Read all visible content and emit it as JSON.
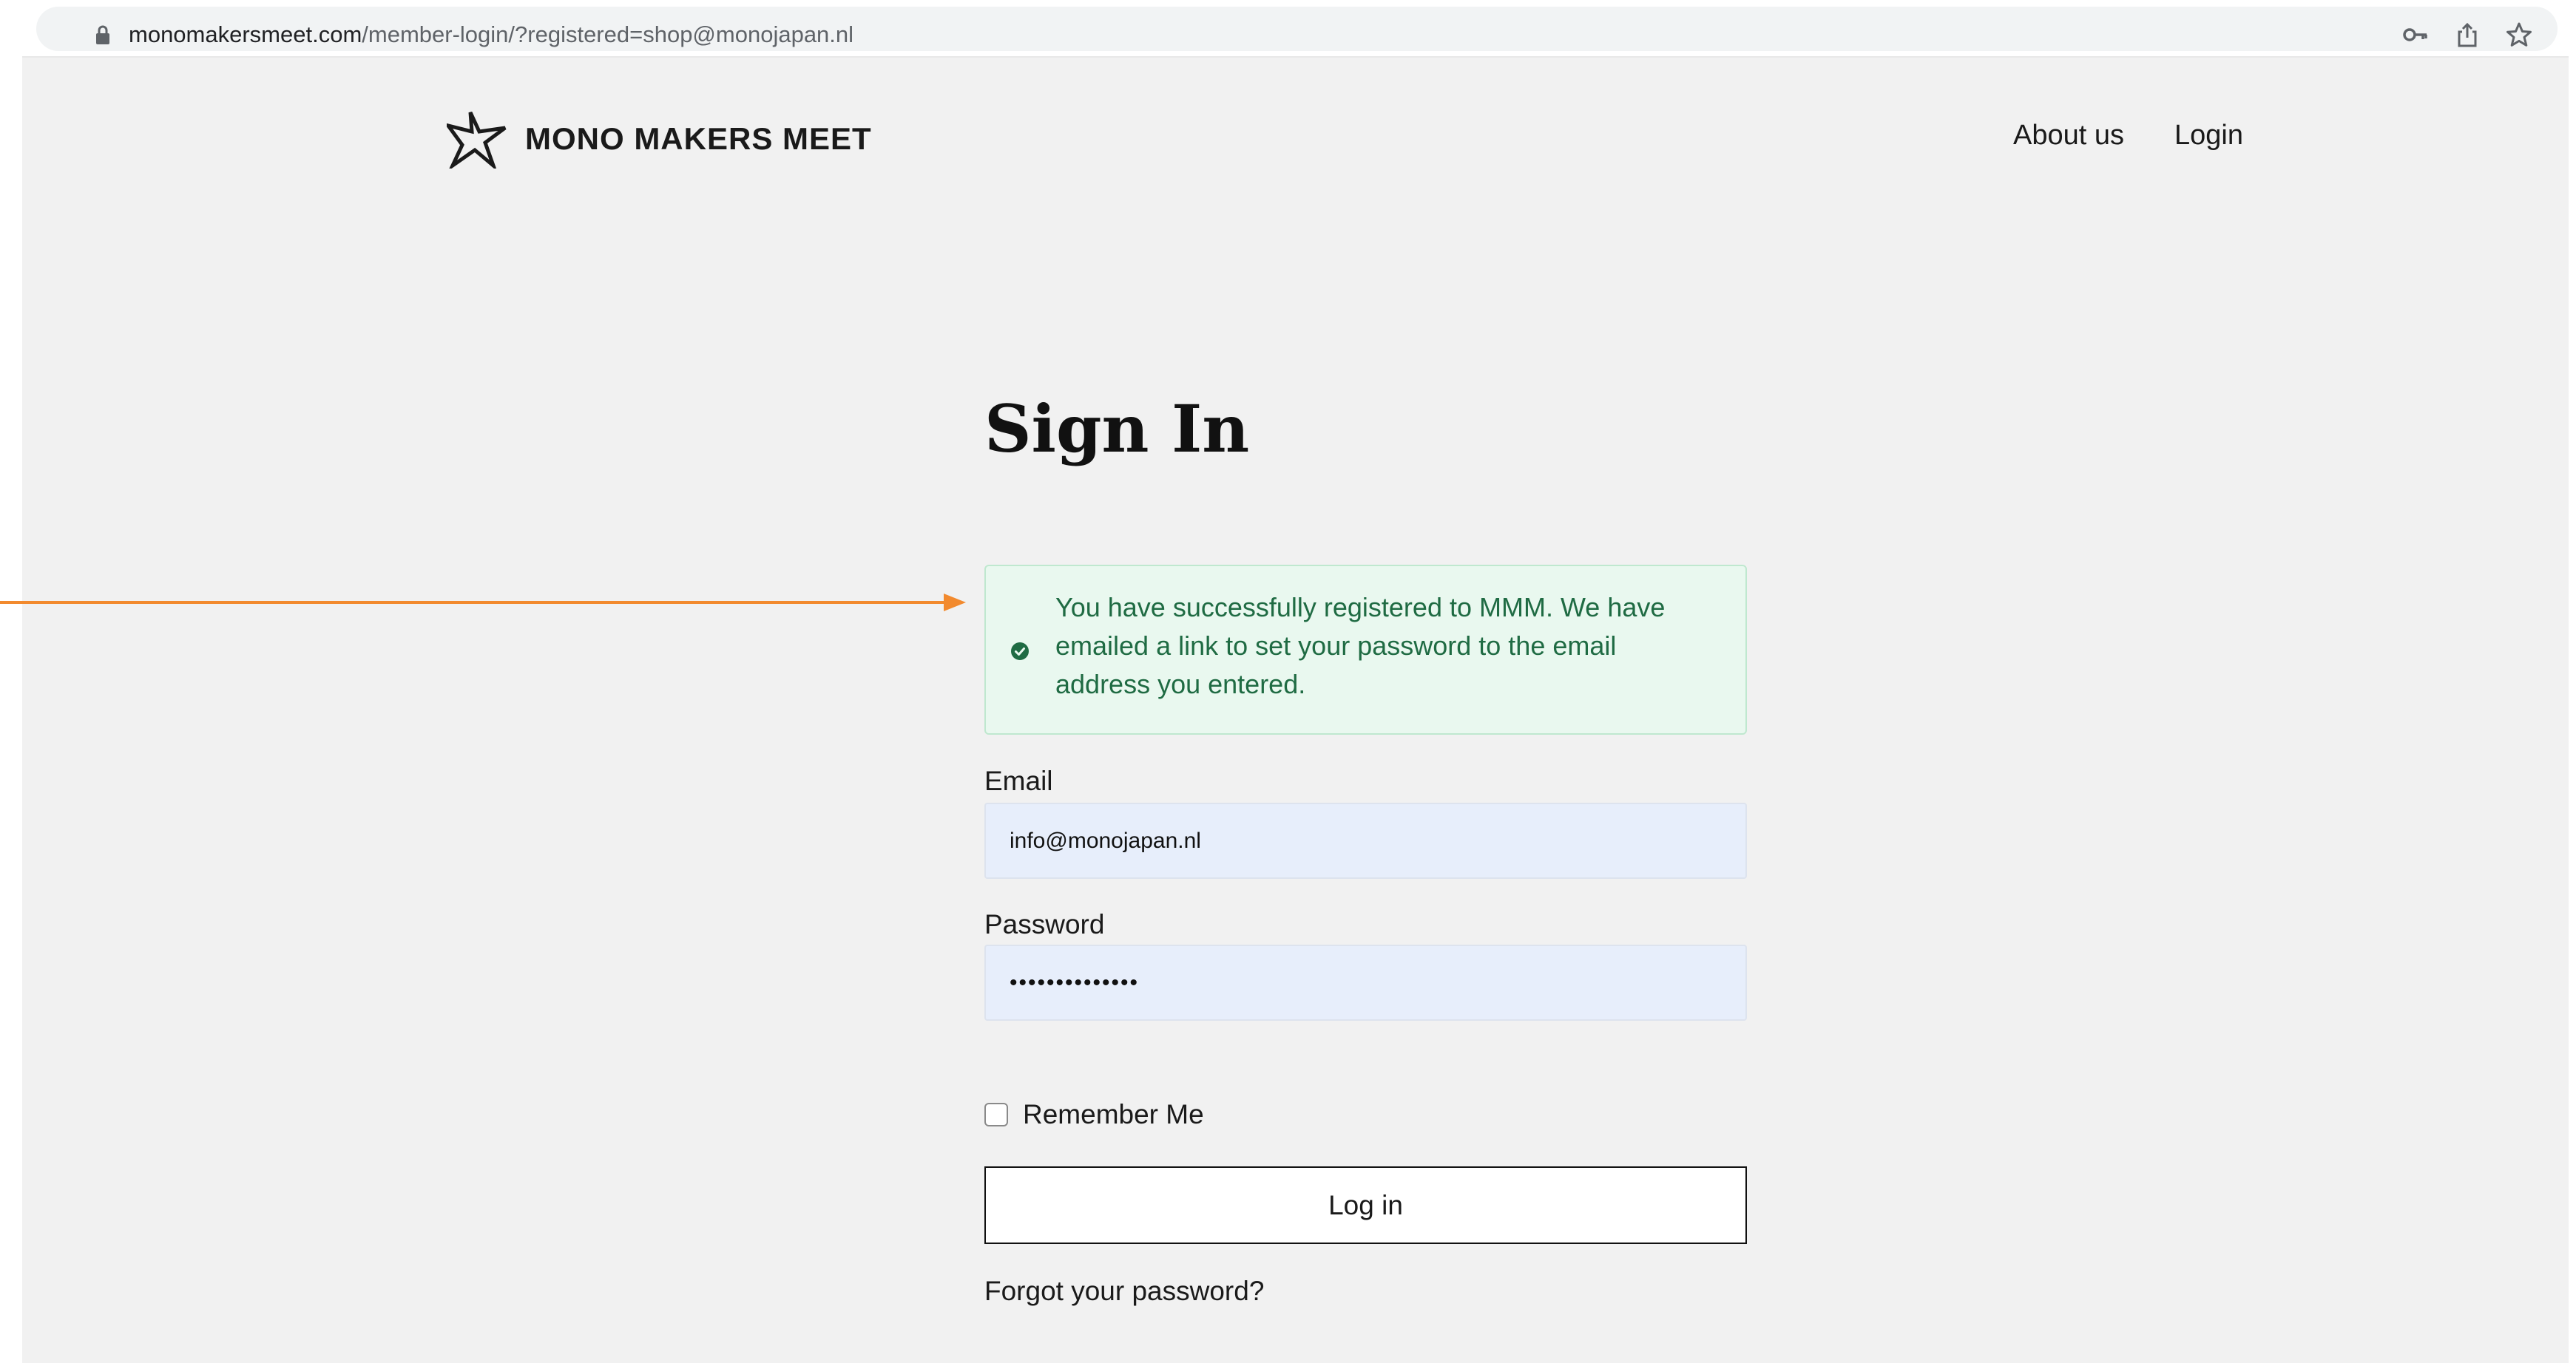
{
  "browser": {
    "url_domain": "monomakersmeet.com",
    "url_path": "/member-login/?registered=shop@monojapan.nl",
    "icons": [
      "lock-icon",
      "key-icon",
      "share-icon",
      "star-icon"
    ]
  },
  "header": {
    "logo_text": "MONO MAKERS MEET",
    "nav": {
      "about": "About us",
      "login": "Login"
    }
  },
  "main": {
    "title": "Sign In",
    "alert": {
      "message": "You have successfully registered to MMM. We have emailed a link to set your password to the email address you entered.",
      "icon": "check-circle-icon",
      "color": "#1f6b43"
    },
    "email": {
      "label": "Email",
      "value": "info@monojapan.nl"
    },
    "password": {
      "label": "Password",
      "value": "••••••••••••••"
    },
    "remember_label": "Remember Me",
    "login_button": "Log in",
    "forgot_link": "Forgot your password?"
  },
  "annotation": {
    "arrow_color": "#f28a2e"
  }
}
